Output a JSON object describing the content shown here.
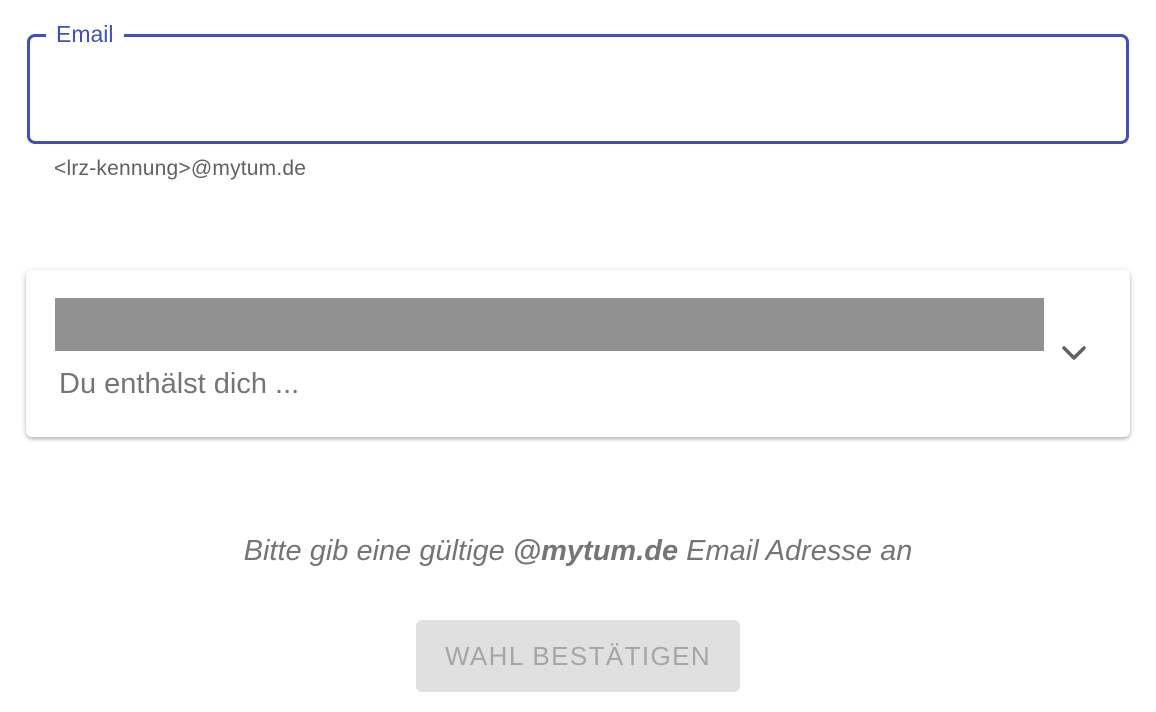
{
  "email": {
    "label": "Email",
    "value": "",
    "helper_text": "<lrz-kennung>@mytum.de"
  },
  "select": {
    "placeholder": "Du enthälst dich ...",
    "icon": "chevron-down-icon"
  },
  "hint": {
    "prefix": "Bitte gib eine gültige ",
    "bold": "@mytum.de",
    "suffix": " Email Adresse an"
  },
  "confirm_button": {
    "label": "WAHL BESTÄTIGEN",
    "disabled": true
  },
  "colors": {
    "accent": "#3f51b5",
    "redacted": "#919191",
    "disabled_bg": "#e0e0e0",
    "disabled_text": "#a6a6a6"
  }
}
